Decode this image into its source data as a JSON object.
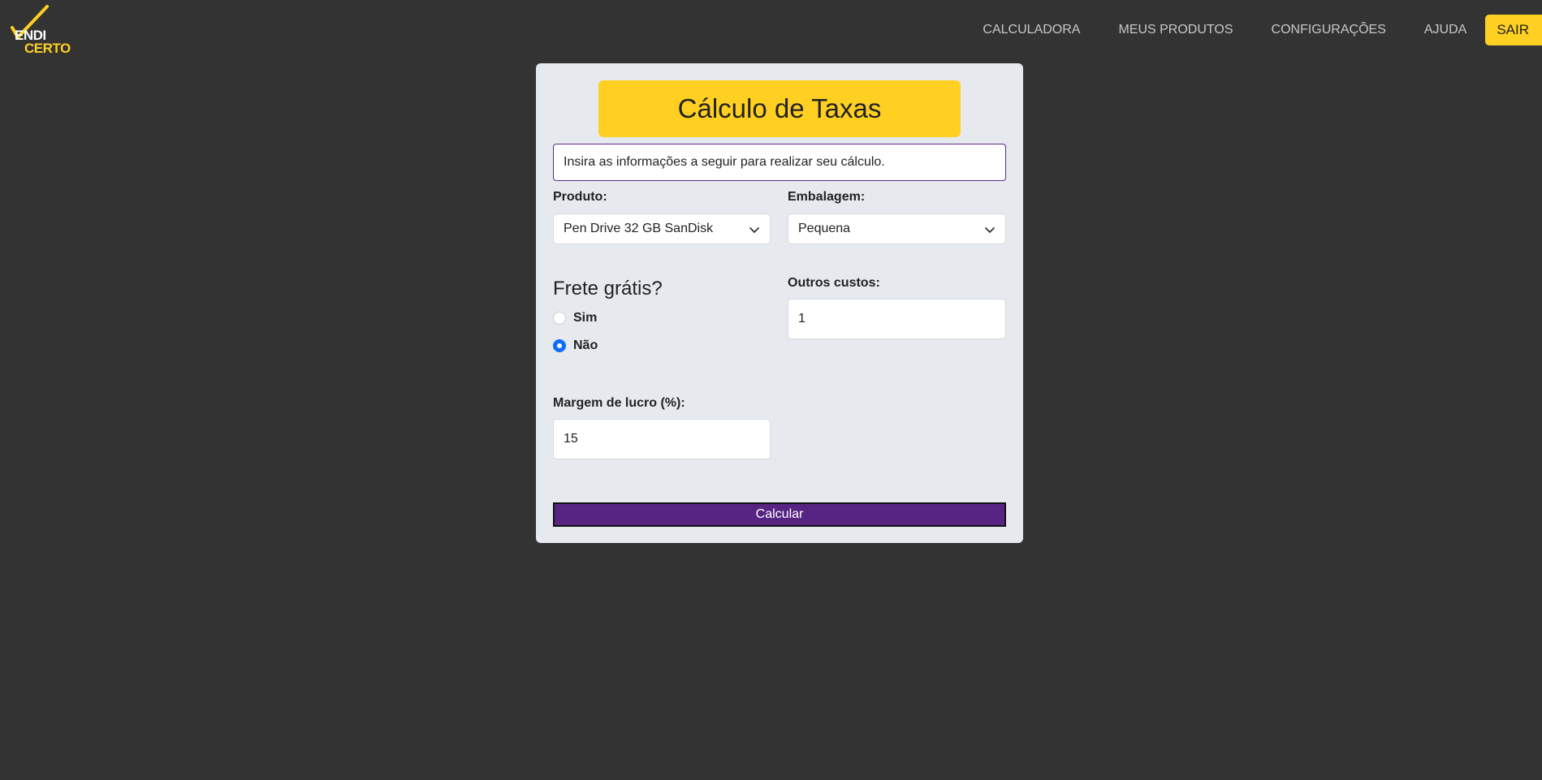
{
  "brand": {
    "logo_line1": "ENDI",
    "logo_line2": "CERTO",
    "logo_icon": "checkmark-icon",
    "accent_color": "#ffd021",
    "primary_color": "#572484"
  },
  "nav": {
    "items": [
      {
        "label": "CALCULADORA"
      },
      {
        "label": "MEUS PRODUTOS"
      },
      {
        "label": "CONFIGURAÇÕES"
      },
      {
        "label": "AJUDA"
      }
    ],
    "logout_label": "SAIR"
  },
  "form": {
    "title": "Cálculo de Taxas",
    "info_text": "Insira as informações a seguir para realizar seu cálculo.",
    "produto": {
      "label": "Produto:",
      "value": "Pen Drive 32 GB SanDisk"
    },
    "embalagem": {
      "label": "Embalagem:",
      "value": "Pequena"
    },
    "frete": {
      "title": "Frete grátis?",
      "options": [
        {
          "label": "Sim",
          "checked": false
        },
        {
          "label": "Não",
          "checked": true
        }
      ]
    },
    "outros_custos": {
      "label": "Outros custos:",
      "value": "1"
    },
    "margem": {
      "label": "Margem de lucro (%):",
      "value": "15"
    },
    "submit_label": "Calcular"
  }
}
